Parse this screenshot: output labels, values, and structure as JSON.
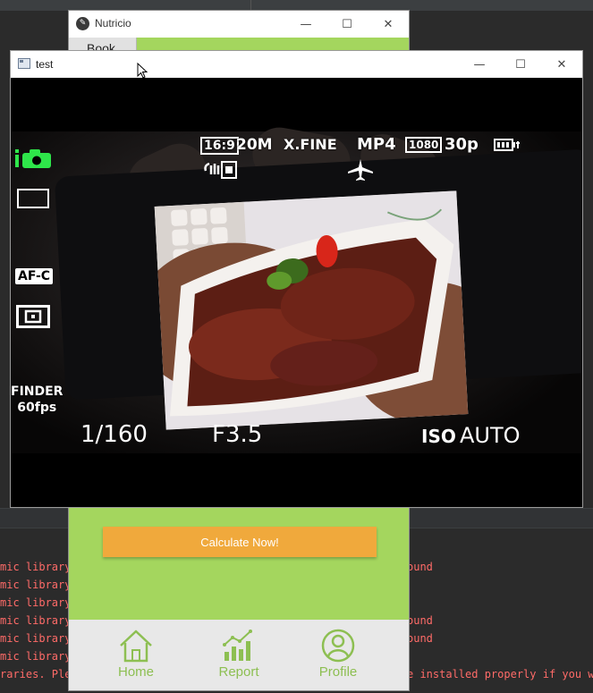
{
  "terminal": {
    "lines_left": [
      "mic library",
      "mic library",
      "mic library",
      "mic library",
      "mic library",
      "mic library",
      "raries. Ple"
    ],
    "lines_right": [
      "ound",
      "",
      "",
      "ound",
      "ound",
      "",
      "e installed properly if you wo"
    ]
  },
  "nutricio": {
    "title": "Nutricio",
    "app_icon": "leaf-icon",
    "book_tab": "Book",
    "calculate_button": "Calculate Now!",
    "colors": {
      "background": "#a4d65e",
      "button": "#f0a93c",
      "nav_accent": "#8dbf52"
    },
    "nav": [
      {
        "label": "Home",
        "icon": "home-icon"
      },
      {
        "label": "Report",
        "icon": "report-chart-icon"
      },
      {
        "label": "Profile",
        "icon": "profile-icon"
      }
    ]
  },
  "testwin": {
    "title": "test",
    "window_controls": {
      "minimize": "—",
      "maximize": "☐",
      "close": "✕"
    }
  },
  "camera_hud": {
    "aspect": "16:9",
    "resolution": "20M",
    "quality": "X.FINE",
    "format": "MP4",
    "video_size": "1080",
    "frame_rate": "30p",
    "focus_mode": "AF-C",
    "finder": "FINDER",
    "finder_fps": "60fps",
    "shutter": "1/160",
    "aperture": "F3.5",
    "iso_label": "ISO",
    "iso_value": "AUTO",
    "icons": [
      "intelligent-auto-camera-icon",
      "frame-mode-icon",
      "focus-area-icon",
      "steadyshot-icon",
      "airplane-mode-icon",
      "battery-icon"
    ]
  }
}
